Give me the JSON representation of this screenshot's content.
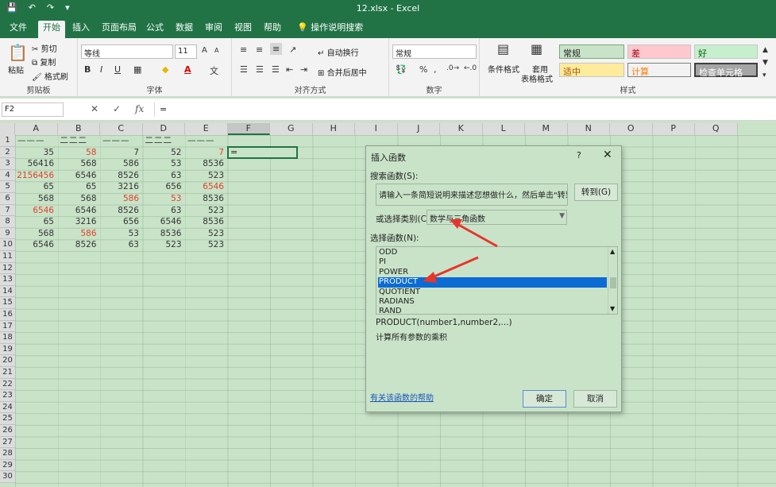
{
  "window": {
    "title": "12.xlsx  -  Excel"
  },
  "tabs": [
    "文件",
    "开始",
    "插入",
    "页面布局",
    "公式",
    "数据",
    "审阅",
    "视图",
    "帮助",
    "操作说明搜索"
  ],
  "active_tab": "开始",
  "clipboard": {
    "paste": "粘贴",
    "cut": "剪切",
    "copy": "复制",
    "format_painter": "格式刷",
    "label": "剪贴板"
  },
  "font": {
    "name": "等线",
    "size": "11",
    "bold": "B",
    "italic": "I",
    "underline": "U",
    "label": "字体",
    "grow": "A",
    "shrink": "A",
    "font_color": "A",
    "wen": "文"
  },
  "alignment": {
    "wrap": "自动换行",
    "merge": "合并后居中",
    "label": "对齐方式"
  },
  "number": {
    "format": "常规",
    "percent": "%",
    "comma": ",",
    "label": "数字"
  },
  "styles": {
    "conditional": "条件格式",
    "table_format_1": "套用",
    "table_format_2": "表格格式",
    "normal": "常规",
    "bad": "差",
    "good": "好",
    "neutral": "适中",
    "calc": "计算",
    "check": "检查单元格",
    "label": "样式"
  },
  "formula_bar": {
    "name_box": "F2",
    "cancel": "✕",
    "enter": "✓",
    "fx": "fx",
    "content": "="
  },
  "columns": [
    "A",
    "B",
    "C",
    "D",
    "E",
    "F",
    "G",
    "H",
    "I",
    "J",
    "K",
    "L",
    "M",
    "N",
    "O",
    "P",
    "Q"
  ],
  "rows": [
    "1",
    "2",
    "3",
    "4",
    "5",
    "6",
    "7",
    "8",
    "9",
    "10",
    "11",
    "12",
    "13",
    "14",
    "15",
    "16",
    "17",
    "18",
    "19",
    "20",
    "21",
    "22",
    "23",
    "24",
    "25",
    "26",
    "27",
    "28",
    "29",
    "30"
  ],
  "sheet": {
    "header": [
      "———",
      "二二二",
      "———",
      "二二二",
      "———"
    ],
    "data": [
      [
        {
          "v": "35"
        },
        {
          "v": "58",
          "red": true
        },
        {
          "v": "7"
        },
        {
          "v": "52"
        },
        {
          "v": "7",
          "red": true
        }
      ],
      [
        {
          "v": "56416"
        },
        {
          "v": "568"
        },
        {
          "v": "586"
        },
        {
          "v": "53"
        },
        {
          "v": "8536"
        }
      ],
      [
        {
          "v": "2156456",
          "red": true
        },
        {
          "v": "6546"
        },
        {
          "v": "8526"
        },
        {
          "v": "63"
        },
        {
          "v": "523"
        }
      ],
      [
        {
          "v": "65"
        },
        {
          "v": "65"
        },
        {
          "v": "3216"
        },
        {
          "v": "656"
        },
        {
          "v": "6546",
          "red": true
        }
      ],
      [
        {
          "v": "568"
        },
        {
          "v": "568"
        },
        {
          "v": "586",
          "red": true
        },
        {
          "v": "53",
          "red": true
        },
        {
          "v": "8536"
        }
      ],
      [
        {
          "v": "6546",
          "red": true
        },
        {
          "v": "6546"
        },
        {
          "v": "8526"
        },
        {
          "v": "63"
        },
        {
          "v": "523"
        }
      ],
      [
        {
          "v": "65"
        },
        {
          "v": "3216"
        },
        {
          "v": "656"
        },
        {
          "v": "6546"
        },
        {
          "v": "8536"
        }
      ],
      [
        {
          "v": "568"
        },
        {
          "v": "586",
          "red": true
        },
        {
          "v": "53"
        },
        {
          "v": "8536"
        },
        {
          "v": "523"
        }
      ],
      [
        {
          "v": "6546"
        },
        {
          "v": "8526"
        },
        {
          "v": "63"
        },
        {
          "v": "523"
        },
        {
          "v": "523"
        }
      ]
    ],
    "active_cell_value": "="
  },
  "dialog": {
    "title": "插入函数",
    "help": "?",
    "close": "✕",
    "search_label": "搜索函数(S):",
    "search_text": "请输入一条简短说明来描述您想做什么，然后单击\"转到\"",
    "go_button": "转到(G)",
    "category_label": "或选择类别(C):",
    "category_value": "数学与三角函数",
    "function_label": "选择函数(N):",
    "functions": [
      "ODD",
      "PI",
      "POWER",
      "PRODUCT",
      "QUOTIENT",
      "RADIANS",
      "RAND"
    ],
    "selected_function": "PRODUCT",
    "syntax": "PRODUCT(number1,number2,...)",
    "description": "计算所有参数的乘积",
    "help_link": "有关该函数的帮助",
    "ok_button": "确定",
    "cancel_button": "取消"
  },
  "colors": {
    "excel_green": "#217346",
    "sheet_bg": "#c9e3c9",
    "red_text": "#e0402a",
    "selection": "#0a6cd4",
    "arrow": "#e8352b"
  }
}
